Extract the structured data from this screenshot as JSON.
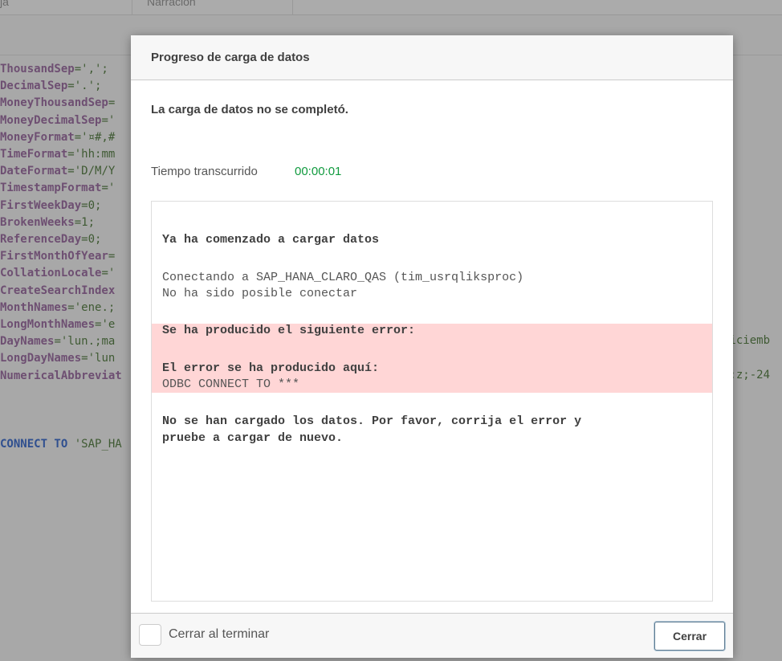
{
  "background": {
    "tabs": [
      "ja",
      "Narración"
    ],
    "code_lines": [
      {
        "k": "ThousandSep",
        "v": "=',';"
      },
      {
        "k": "DecimalSep",
        "v": "='.';"
      },
      {
        "k": "MoneyThousandSep",
        "v": "="
      },
      {
        "k": "MoneyDecimalSep",
        "v": "='"
      },
      {
        "k": "MoneyFormat",
        "v": "='¤#,#"
      },
      {
        "k": "TimeFormat",
        "v": "='hh:mm"
      },
      {
        "k": "DateFormat",
        "v": "='D/M/Y"
      },
      {
        "k": "TimestampFormat",
        "v": "='"
      },
      {
        "k": "FirstWeekDay",
        "v": "=0;"
      },
      {
        "k": "BrokenWeeks",
        "v": "=1;"
      },
      {
        "k": "ReferenceDay",
        "v": "=0;"
      },
      {
        "k": "FirstMonthOfYear",
        "v": "="
      },
      {
        "k": "CollationLocale",
        "v": "='"
      },
      {
        "k": "CreateSearchIndex",
        "v": ""
      },
      {
        "k": "MonthNames",
        "v": "='ene.;"
      },
      {
        "k": "LongMonthNames",
        "v": "='e"
      },
      {
        "k": "DayNames",
        "v": "='lun.;ma"
      },
      {
        "k": "LongDayNames",
        "v": "='lun"
      },
      {
        "k": "NumericalAbbreviat",
        "v": ""
      }
    ],
    "connect_kw": "CONNECT TO",
    "connect_val": "'SAP_HA",
    "right_fragments": [
      "diciemb",
      "1:z;-24"
    ]
  },
  "modal": {
    "title": "Progreso de carga de datos",
    "status": "La carga de datos no se completó.",
    "elapsed_label": "Tiempo transcurrido",
    "elapsed_value": "00:00:01",
    "log": {
      "started": "Ya ha comenzado a cargar datos",
      "connecting": "Conectando a SAP_HANA_CLARO_QAS (tim_usrqliksproc)",
      "not_possible": "No ha sido posible conectar",
      "error_title": "Se ha producido el siguiente error:",
      "error_location": "El error se ha producido aquí:",
      "error_statement": "ODBC CONNECT TO ***",
      "final_1": "No se han cargado los datos. Por favor, corrija el error y",
      "final_2": "pruebe a cargar de nuevo."
    },
    "close_on_finish_label": "Cerrar al terminar",
    "close_on_finish_checked": false,
    "close_button": "Cerrar"
  }
}
